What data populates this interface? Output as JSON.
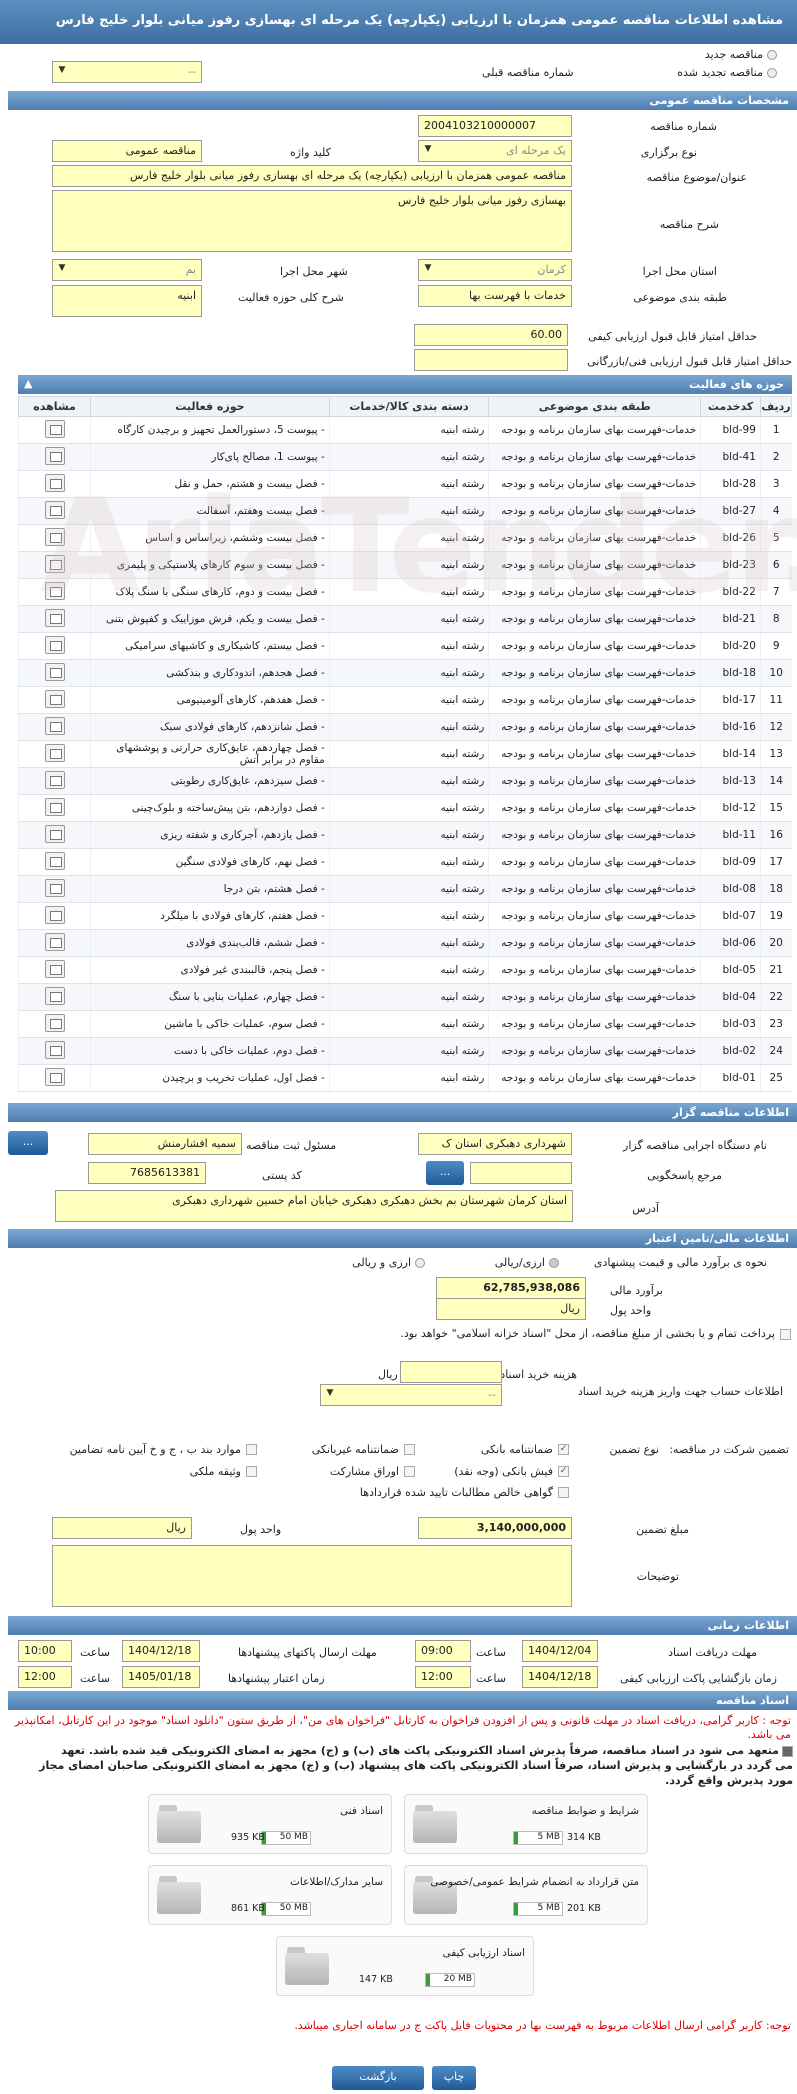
{
  "title": "مشاهده اطلاعات مناقصه عمومی همزمان با ارزیابی (یکپارچه) یک مرحله ای بهسازی رفوز میانی بلوار خلیج فارس",
  "top": {
    "new_tender": "مناقصه جدید",
    "renewed_tender": "مناقصه تجدید شده",
    "prev_tender_label": "شماره مناقصه قبلی",
    "prev_tender_value": "--"
  },
  "general": {
    "header": "مشخصات مناقصه عمومی",
    "number_label": "شماره مناقصه",
    "number_value": "2004103210000007",
    "type_label": "نوع برگزاری",
    "type_value": "یک مرحله ای",
    "keyword_label": "کلید واژه",
    "keyword_value": "مناقصه عمومی",
    "subject_label": "عنوان/موضوع مناقصه",
    "subject_value": "مناقصه عمومی همزمان با ارزیابی (یکپارچه) یک مرحله ای بهسازی رفوز میانی بلوار خلیج فارس",
    "desc_label": "شرح مناقصه",
    "desc_value": "بهسازی رفوز میانی بلوار خلیج فارس",
    "province_label": "استان محل اجرا",
    "province_value": "کرمان",
    "city_label": "شهر محل اجرا",
    "city_value": "بم",
    "category_label": "طبقه بندی موضوعی",
    "category_value": "خدمات با فهرست بها",
    "scope_label": "شرح کلی حوزه فعالیت",
    "scope_value": "ابنیه",
    "min_quality_label": "حداقل امتیاز قابل قبول ارزیابی کیفی",
    "min_quality_value": "60.00",
    "min_tech_label": "حداقل امتیاز قابل قبول ارزیابی فنی/بازرگانی",
    "min_tech_value": ""
  },
  "activities": {
    "header": "حوزه های فعالیت",
    "columns": [
      "ردیف",
      "کدخدمت",
      "طبقه بندی موضوعی",
      "دسته بندی کالا/خدمات",
      "حوزه فعالیت",
      "مشاهده"
    ],
    "rows": [
      [
        "1",
        "bld-99",
        "خدمات-فهرست بهای سازمان برنامه و بودجه",
        "رشته ابنیه",
        "- پیوست 5، دستورالعمل تجهیز و برچیدن کارگاه"
      ],
      [
        "2",
        "bld-41",
        "خدمات-فهرست بهای سازمان برنامه و بودجه",
        "رشته ابنیه",
        "- پیوست 1، مصالح پای‌کار"
      ],
      [
        "3",
        "bld-28",
        "خدمات-فهرست بهای سازمان برنامه و بودجه",
        "رشته ابنیه",
        "- فصل بیست و هشتم، حمل و نقل"
      ],
      [
        "4",
        "bld-27",
        "خدمات-فهرست بهای سازمان برنامه و بودجه",
        "رشته ابنیه",
        "- فصل بیست وهفتم، آسفالت"
      ],
      [
        "5",
        "bld-26",
        "خدمات-فهرست بهای سازمان برنامه و بودجه",
        "رشته ابنیه",
        "- فصل بیست وششم، زیراساس و اساس"
      ],
      [
        "6",
        "bld-23",
        "خدمات-فهرست بهای سازمان برنامه و بودجه",
        "رشته ابنیه",
        "- فصل بیست و سوم کارهای پلاستیکی و پلیمری"
      ],
      [
        "7",
        "bld-22",
        "خدمات-فهرست بهای سازمان برنامه و بودجه",
        "رشته ابنیه",
        "- فصل بیست و دوم، کارهای سنگی با سنگ پلاک"
      ],
      [
        "8",
        "bld-21",
        "خدمات-فهرست بهای سازمان برنامه و بودجه",
        "رشته ابنیه",
        "- فصل بیست و یکم، فرش موزاییک و کفپوش بتنی"
      ],
      [
        "9",
        "bld-20",
        "خدمات-فهرست بهای سازمان برنامه و بودجه",
        "رشته ابنیه",
        "- فصل بیستم، کاشیکاری و کاشیهای سرامیکی"
      ],
      [
        "10",
        "bld-18",
        "خدمات-فهرست بهای سازمان برنامه و بودجه",
        "رشته ابنیه",
        "- فصل هجدهم، اندودکاری و بندکشی"
      ],
      [
        "11",
        "bld-17",
        "خدمات-فهرست بهای سازمان برنامه و بودجه",
        "رشته ابنیه",
        "- فصل هفدهم، کارهای آلومینیومی"
      ],
      [
        "12",
        "bld-16",
        "خدمات-فهرست بهای سازمان برنامه و بودجه",
        "رشته ابنیه",
        "- فصل شانزدهم، کارهای فولادی سبک"
      ],
      [
        "13",
        "bld-14",
        "خدمات-فهرست بهای سازمان برنامه و بودجه",
        "رشته ابنیه",
        "- فصل چهاردهم، عایق‌کاری حرارتی و پوششهای مقاوم در برابر آتش"
      ],
      [
        "14",
        "bld-13",
        "خدمات-فهرست بهای سازمان برنامه و بودجه",
        "رشته ابنیه",
        "- فصل سیزدهم، عایق‌کاری رطوبتی"
      ],
      [
        "15",
        "bld-12",
        "خدمات-فهرست بهای سازمان برنامه و بودجه",
        "رشته ابنیه",
        "- فصل دوازدهم، بتن پیش‌ساخته و بلوک‌چینی"
      ],
      [
        "16",
        "bld-11",
        "خدمات-فهرست بهای سازمان برنامه و بودجه",
        "رشته ابنیه",
        "- فصل یازدهم، آجرکاری و شفته ریزی"
      ],
      [
        "17",
        "bld-09",
        "خدمات-فهرست بهای سازمان برنامه و بودجه",
        "رشته ابنیه",
        "- فصل نهم، کارهای فولادی سنگین"
      ],
      [
        "18",
        "bld-08",
        "خدمات-فهرست بهای سازمان برنامه و بودجه",
        "رشته ابنیه",
        "- فصل هشتم، بتن درجا"
      ],
      [
        "19",
        "bld-07",
        "خدمات-فهرست بهای سازمان برنامه و بودجه",
        "رشته ابنیه",
        "- فصل هفتم، کارهای فولادی با میلگرد"
      ],
      [
        "20",
        "bld-06",
        "خدمات-فهرست بهای سازمان برنامه و بودجه",
        "رشته ابنیه",
        "- فصل ششم، قالب‌بندی فولادی"
      ],
      [
        "21",
        "bld-05",
        "خدمات-فهرست بهای سازمان برنامه و بودجه",
        "رشته ابنیه",
        "- فصل پنجم، قالببندی غیر فولادی"
      ],
      [
        "22",
        "bld-04",
        "خدمات-فهرست بهای سازمان برنامه و بودجه",
        "رشته ابنیه",
        "- فصل چهارم، عملیات بنایی با سنگ"
      ],
      [
        "23",
        "bld-03",
        "خدمات-فهرست بهای سازمان برنامه و بودجه",
        "رشته ابنیه",
        "- فصل سوم، عملیات خاکی با ماشین"
      ],
      [
        "24",
        "bld-02",
        "خدمات-فهرست بهای سازمان برنامه و بودجه",
        "رشته ابنیه",
        "- فصل دوم، عملیات خاکی با دست"
      ],
      [
        "25",
        "bld-01",
        "خدمات-فهرست بهای سازمان برنامه و بودجه",
        "رشته ابنیه",
        "- فصل اول، عملیات تخریب و برچیدن"
      ]
    ]
  },
  "organizer": {
    "header": "اطلاعات مناقصه گزار",
    "org_label": "نام دستگاه اجرایی مناقصه گزار",
    "org_value": "شهرداری دهبکری استان ک",
    "officer_label": "مسئول ثبت مناقصه",
    "officer_value": "سمیه افشارمنش",
    "ref_label": "مرجع پاسخگویی",
    "ref_value": "",
    "postal_label": "کد پستی",
    "postal_value": "7685613381",
    "address_label": "آدرس",
    "address_value": "استان کرمان شهرستان بم بخش دهبکری دهبکری خیابان امام حسین شهرداری  دهبکری",
    "more_btn": "..."
  },
  "finance": {
    "header": "اطلاعات مالی/تامین اعتبار",
    "estimate_label": "نحوه ی برآورد مالی و قیمت پیشنهادی",
    "opt_currency_rial": "ارزی/ریالی",
    "opt_currency_and_rial": "ارزی و ریالی",
    "estimate_amount_label": "برآورد مالی",
    "estimate_amount_value": "62,785,938,086",
    "currency_label": "واحد پول",
    "currency_value": "ریال",
    "treasury_text": "پرداخت تمام و یا بخشی از مبلغ مناقصه، از محل \"اسناد خزانه اسلامی\" خواهد بود.",
    "doc_fee_label": "هزینه خرید اسناد",
    "doc_fee_value": "",
    "doc_fee_unit": "ریال",
    "account_label": "اطلاعات حساب جهت واریز هزینه خرید اسناد",
    "account_value": "--"
  },
  "guarantee": {
    "participation_label": "تضمین شرکت در مناقصه:",
    "type_label": "نوع تضمین",
    "options": {
      "bank_guarantee": "ضمانتنامه بانکی",
      "nonbank_guarantee": "ضمانتنامه غیربانکی",
      "clauses": "موارد بند ب ، ج و خ آیین نامه تضامین",
      "bank_receipt": "فیش بانکی (وجه نقد)",
      "partnership_papers": "اوراق مشارکت",
      "property": "وثیقه ملکی",
      "claims_certificate": "گواهی خالص مطالبات تایید شده قراردادها"
    },
    "amount_label": "مبلغ تضمین",
    "amount_value": "3,140,000,000",
    "unit_label": "واحد پول",
    "unit_value": "ریال",
    "notes_label": "توضیحات",
    "notes_value": ""
  },
  "timing": {
    "header": "اطلاعات زمانی",
    "receive_deadline_label": "مهلت دریافت اسناد",
    "receive_date": "1404/12/04",
    "receive_time": "09:00",
    "send_deadline_label": "مهلت ارسال پاکتهای پیشنهادها",
    "send_date": "1404/12/18",
    "send_time": "10:00",
    "opening_label": "زمان بازگشایی پاکت ارزیابی کیفی",
    "opening_date": "1404/12/18",
    "opening_time": "12:00",
    "validity_label": "زمان اعتبار پیشنهادها",
    "validity_date": "1405/01/18",
    "validity_time": "12:00",
    "time_label": "ساعت"
  },
  "documents": {
    "header": "اسناد مناقصه",
    "note1_line1": "توجه : کاربر گرامی، دریافت اسناد در مهلت قانونی و پس از افزودن فراخوان به کارتابل \"فراخوان های من\"، از طریق ستون \"دانلود اسناد\" موجود در این کارتابل، امکانپذیر می باشد.",
    "commit_line1": "متعهد می شود در اسناد مناقصه، صرفاً پذیرش اسناد الکترونیکی پاکت های (ب) و (ج) مجهز به امضای الکترونیکی قید شده باشد. تعهد",
    "commit_line2": "می گردد در بارگشایی و پذیرش اسناد، صرفاً اسناد الکترونیکی پاکت های پیشنهاد (ب) و (ج) مجهز به امضای الکترونیکی صاحبان امضای مجاز",
    "commit_line3": "مورد پذیرش واقع گردد.",
    "files": [
      {
        "name": "شرایط و ضوابط مناقصه",
        "size": "314 KB",
        "max": "5 MB"
      },
      {
        "name": "اسناد فنی",
        "size": "935 KB",
        "max": "50 MB"
      },
      {
        "name": "متن قرارداد به انضمام شرایط عمومی/خصوصی",
        "size": "201 KB",
        "max": "5 MB"
      },
      {
        "name": "سایر مدارک/اطلاعات",
        "size": "861 KB",
        "max": "50 MB"
      },
      {
        "name": "اسناد ارزیابی کیفی",
        "size": "147 KB",
        "max": "20 MB"
      }
    ],
    "note2": "توجه: کاربر گرامی ارسال اطلاعات مربوط به فهرست بها در محتویات فایل پاکت ج در سامانه اجباری میباشد."
  },
  "footer": {
    "print_btn": "چاپ",
    "back_btn": "بازگشت"
  },
  "watermark": "AriaTender.net"
}
